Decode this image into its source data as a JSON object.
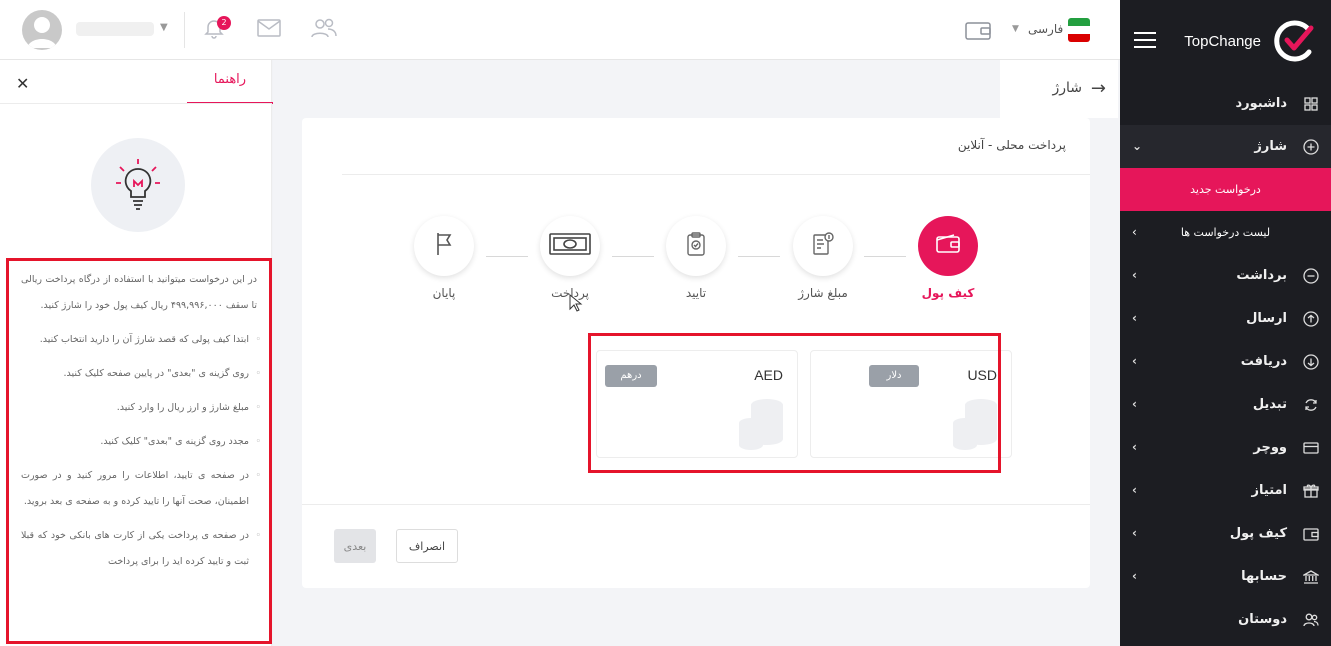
{
  "sidebar": {
    "brand": "TopChange",
    "items": [
      {
        "label": "داشبورد",
        "icon": "grid-icon"
      },
      {
        "label": "شارژ",
        "icon": "plus-circle-icon"
      },
      {
        "label": "برداشت",
        "icon": "minus-circle-icon"
      },
      {
        "label": "ارسال",
        "icon": "arrow-up-circle-icon"
      },
      {
        "label": "دریافت",
        "icon": "arrow-down-circle-icon"
      },
      {
        "label": "تبدیل",
        "icon": "refresh-icon"
      },
      {
        "label": "ووچر",
        "icon": "card-icon"
      },
      {
        "label": "امتیاز",
        "icon": "gift-icon"
      },
      {
        "label": "کیف پول",
        "icon": "wallet-icon"
      },
      {
        "label": "حسابها",
        "icon": "bank-icon"
      },
      {
        "label": "دوستان",
        "icon": "users-icon"
      }
    ],
    "charge_sub": [
      {
        "label": "درخواست جدید"
      },
      {
        "label": "لیست درخواست ها"
      }
    ]
  },
  "topbar": {
    "language": "فارسی",
    "notification_count": "2"
  },
  "help": {
    "tab": "راهنما",
    "intro": "در این درخواست میتوانید با استفاده از درگاه پرداخت ریالی تا سقف ۴۹۹,۹۹۶,۰۰۰ ریال کیف پول خود را شارژ کنید.",
    "steps": [
      "ابتدا کیف پولی که قصد شارژ آن را دارید انتخاب کنید.",
      "روی گزینه ی \"بعدی\" در پایین صفحه کلیک کنید.",
      "مبلغ شارژ و ارز ریال را وارد کنید.",
      "مجدد روی گزینه ی \"بعدی\" کلیک کنید.",
      "در صفحه ی تایید، اطلاعات را مرور کنید و در صورت اطمینان، صحت آنها را تایید کرده و به صفحه ی بعد بروید.",
      "در صفحه ی پرداخت یکی از کارت های بانکی خود که قبلا ثبت و تایید کرده اید را برای پرداخت"
    ]
  },
  "page": {
    "title": "شارژ",
    "card_title": "پرداخت محلی - آنلاین"
  },
  "wizard": {
    "steps": [
      {
        "label": "کیف پول",
        "icon": "wallet-icon"
      },
      {
        "label": "مبلغ شارژ",
        "icon": "receipt-icon"
      },
      {
        "label": "تایید",
        "icon": "clipboard-check-icon"
      },
      {
        "label": "پرداخت",
        "icon": "banknote-icon"
      },
      {
        "label": "پایان",
        "icon": "flag-icon"
      }
    ]
  },
  "wallets": [
    {
      "code": "USD",
      "name": "دلار"
    },
    {
      "code": "AED",
      "name": "درهم"
    }
  ],
  "buttons": {
    "next": "بعدی",
    "cancel": "انصراف"
  },
  "colors": {
    "accent": "#e6165a",
    "sidebar_bg": "#1c1d22",
    "highlight_frame": "#e5142b"
  }
}
